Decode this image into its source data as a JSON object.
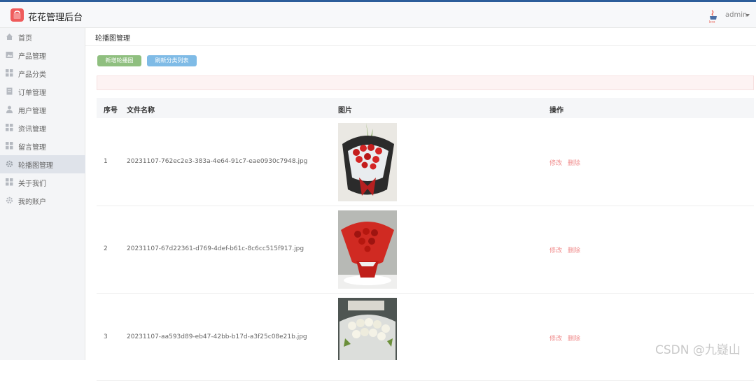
{
  "header": {
    "title": "花花管理后台",
    "user": "admin",
    "brand_color": "#ef5b5b"
  },
  "sidebar": {
    "items": [
      {
        "label": "首页",
        "icon": "home-icon"
      },
      {
        "label": "产品管理",
        "icon": "image-icon"
      },
      {
        "label": "产品分类",
        "icon": "grid-icon"
      },
      {
        "label": "订单管理",
        "icon": "document-icon"
      },
      {
        "label": "用户管理",
        "icon": "user-icon"
      },
      {
        "label": "资讯管理",
        "icon": "grid-icon"
      },
      {
        "label": "留言管理",
        "icon": "grid-icon"
      },
      {
        "label": "轮播图管理",
        "icon": "gear-icon",
        "active": true
      },
      {
        "label": "关于我们",
        "icon": "grid-icon"
      },
      {
        "label": "我的账户",
        "icon": "gear-icon"
      }
    ]
  },
  "breadcrumb": "轮播图管理",
  "toolbar": {
    "add_label": "新增轮播图",
    "refresh_label": "刷新分类列表"
  },
  "table": {
    "headers": [
      "序号",
      "文件名称",
      "图片",
      "操作"
    ],
    "rows": [
      {
        "index": "1",
        "file": "20231107-762ec2e3-383a-4e64-91c7-eae0930c7948.jpg",
        "edit": "修改",
        "delete": "删除"
      },
      {
        "index": "2",
        "file": "20231107-67d22361-d769-4def-b61c-8c6cc515f917.jpg",
        "edit": "修改",
        "delete": "删除"
      },
      {
        "index": "3",
        "file": "20231107-aa593d89-eb47-42bb-b17d-a3f25c08e21b.jpg",
        "edit": "修改",
        "delete": "删除"
      }
    ]
  },
  "watermark": "CSDN @九嶷山"
}
